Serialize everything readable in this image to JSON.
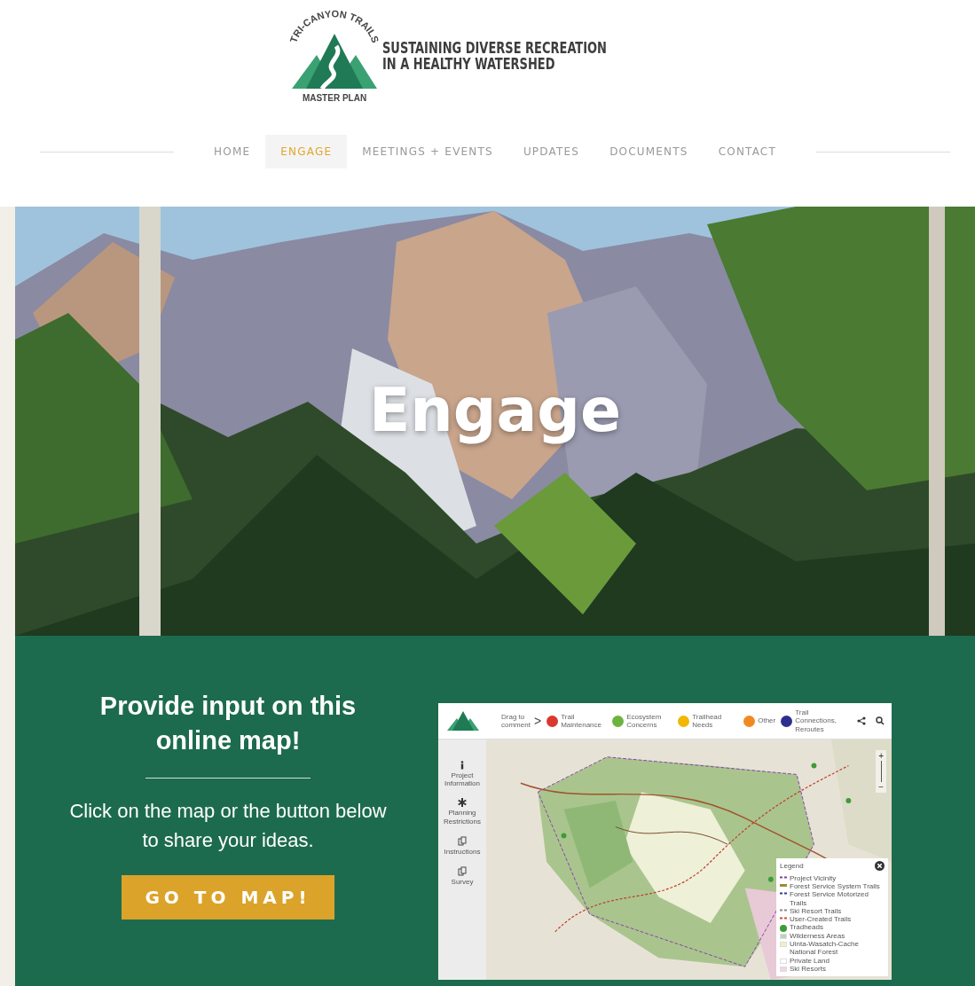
{
  "logo": {
    "arc_text": "TRI-CANYON TRAILS",
    "subtitle": "MASTER PLAN",
    "tagline": [
      "SUSTAINING DIVERSE RECREATION",
      "IN A HEALTHY WATERSHED"
    ]
  },
  "nav": [
    {
      "label": "HOME",
      "selected": false
    },
    {
      "label": "ENGAGE",
      "selected": true
    },
    {
      "label": "MEETINGS + EVENTS",
      "selected": false
    },
    {
      "label": "UPDATES",
      "selected": false
    },
    {
      "label": "DOCUMENTS",
      "selected": false
    },
    {
      "label": "CONTACT",
      "selected": false
    }
  ],
  "hero": {
    "title": "Engage",
    "kind": "picture"
  },
  "engage": {
    "heading": "Provide input on this online map!",
    "text": "Click on the map or the button below to share your ideas.",
    "button": "GO TO MAP!"
  },
  "map_preview": {
    "drag_hint": "Drag to comment",
    "arrow": ">",
    "categories": [
      {
        "label": "Trail Maintenance",
        "color": "#d9392c"
      },
      {
        "label": "Ecosystem Concerns",
        "color": "#6db33f"
      },
      {
        "label": "Trailhead Needs",
        "color": "#f2b705"
      },
      {
        "label": "Other",
        "color": "#ef8a22"
      },
      {
        "label": "Trail Connections, Reroutes",
        "color": "#2d2f8f"
      }
    ],
    "sidebar": [
      {
        "label": "Project Information",
        "kind": "info"
      },
      {
        "label": "Planning Restrictions",
        "kind": "asterisk"
      },
      {
        "label": "Instructions",
        "kind": "pages"
      },
      {
        "label": "Survey",
        "kind": "pages"
      }
    ],
    "zoom": {
      "plus": "+",
      "minus": "−"
    },
    "legend": {
      "title": "Legend",
      "items": [
        {
          "label": "Project Vicinity",
          "kind": "dashed",
          "color": "#7b3fa8"
        },
        {
          "label": "Forest Service System Trails",
          "kind": "solid",
          "color": "#9c8b3a"
        },
        {
          "label": "Forest Service Motorized Trails",
          "kind": "dashed",
          "color": "#34398c"
        },
        {
          "label": "Ski Resort Trails",
          "kind": "dashed",
          "color": "#8a8a8a"
        },
        {
          "label": "User-Created Trails",
          "kind": "dashed",
          "color": "#e0403a"
        },
        {
          "label": "Tradheads",
          "kind": "pin",
          "color": "#3f9a3a"
        },
        {
          "label": "Wilderness Areas",
          "kind": "swatch",
          "color": "#bcd3b4"
        },
        {
          "label": "Uinta-Wasatch-Cache National Forest",
          "kind": "swatch",
          "color": "#eef0c6"
        },
        {
          "label": "Private Land",
          "kind": "swatch",
          "color": "#ffffff"
        },
        {
          "label": "Ski Resorts",
          "kind": "swatch",
          "color": "#f2d4e4"
        }
      ]
    }
  }
}
